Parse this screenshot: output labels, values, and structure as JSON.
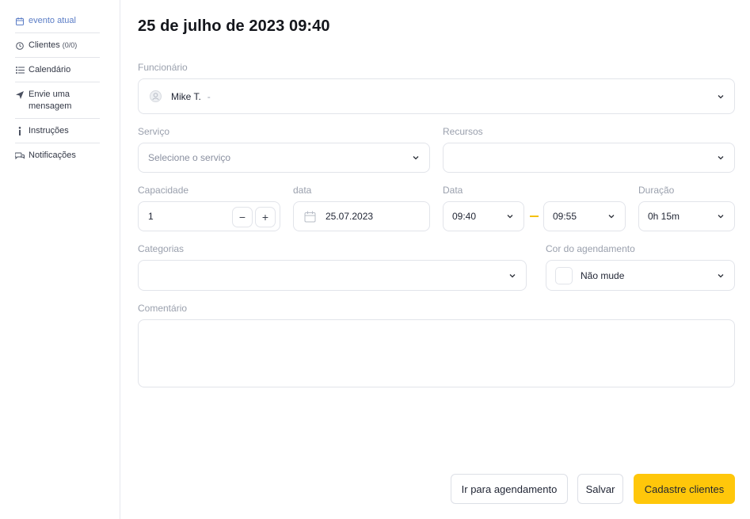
{
  "sidebar": {
    "items": [
      {
        "label": "evento atual",
        "icon": "calendar-icon",
        "active": true
      },
      {
        "label": "Clientes",
        "badge": "(0/0)",
        "icon": "clock-icon"
      },
      {
        "label": "Calendário",
        "icon": "list-icon"
      },
      {
        "label": "Envie uma mensagem",
        "icon": "send-icon"
      },
      {
        "label": "Instruções",
        "icon": "info-icon"
      },
      {
        "label": "Notificações",
        "icon": "chat-icon"
      }
    ]
  },
  "main": {
    "title": "25 de julho de 2023 09:40",
    "employee": {
      "label": "Funcionário",
      "value": "Mike T.",
      "suffix": "-"
    },
    "service": {
      "label": "Serviço",
      "placeholder": "Selecione o serviço"
    },
    "resources": {
      "label": "Recursos",
      "value": ""
    },
    "capacity": {
      "label": "Capacidade",
      "value": "1",
      "minus": "−",
      "plus": "+"
    },
    "date": {
      "label": "data",
      "value": "25.07.2023"
    },
    "time": {
      "label": "Data",
      "start": "09:40",
      "end": "09:55"
    },
    "duration": {
      "label": "Duração",
      "value": "0h 15m"
    },
    "categories": {
      "label": "Categorias",
      "value": ""
    },
    "color": {
      "label": "Cor do agendamento",
      "value": "Não mude"
    },
    "comment": {
      "label": "Comentário",
      "value": ""
    }
  },
  "actions": {
    "goto": "Ir para agendamento",
    "save": "Salvar",
    "register": "Cadastre clientes"
  },
  "colors": {
    "accent": "#ffc70a",
    "active_link": "#5b7dc6",
    "separator_dash": "#f4c10b"
  }
}
